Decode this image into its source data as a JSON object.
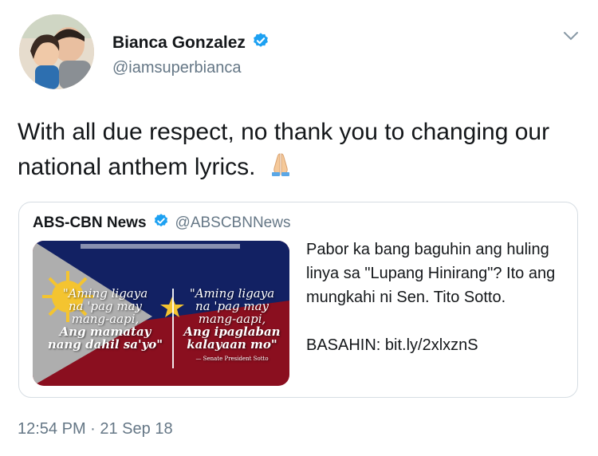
{
  "author": {
    "name": "Bianca Gonzalez",
    "handle": "@iamsuperbianca",
    "verified_icon": "verified-badge-icon",
    "avatar": "profile-photo"
  },
  "tweet": {
    "text": "With all due respect, no thank you to changing our national anthem lyrics.",
    "emoji": "folded-hands"
  },
  "quoted": {
    "name": "ABS-CBN News",
    "handle": "@ABSCBNNews",
    "text_1": "Pabor ka bang baguhin ang huling linya sa \"Lupang Hinirang\"? Ito ang mungkahi ni Sen. Tito Sotto.",
    "text_2": "BASAHIN: bit.ly/2xlxznS",
    "image": {
      "left_lines": [
        "\"Aming ligaya",
        "na 'pag may",
        "mang-aapi,",
        "Ang mamatay",
        "nang dahil sa'yo\""
      ],
      "right_lines": [
        "\"Aming ligaya",
        "na 'pag may",
        "mang-aapi,",
        "Ang ipaglaban",
        "kalayaan mo\""
      ],
      "right_credit": "— Senate President Sotto"
    }
  },
  "timestamp": "12:54 PM · 21 Sep 18",
  "colors": {
    "verified": "#1da1f2",
    "secondary_text": "#657786",
    "flag_blue": "#1a2f8a",
    "flag_red": "#c0162b",
    "sun_yellow": "#f4c430"
  }
}
